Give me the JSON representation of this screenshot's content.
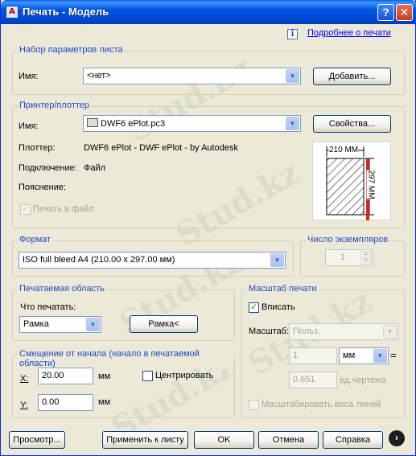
{
  "window": {
    "title": "Печать - Модель",
    "app_icon": "autocad-icon",
    "help_glyph": "?",
    "close_glyph": "✕"
  },
  "help_link": "Подробнее о печати",
  "page_setup": {
    "legend": "Набор параметров листа",
    "name_label": "Имя:",
    "name_value": "<нет>",
    "add_button": "Добавить..."
  },
  "printer": {
    "legend": "Принтер/плоттер",
    "name_label": "Имя:",
    "name_value": "DWF6 ePlot.pc3",
    "properties_button": "Свойства...",
    "plotter_label": "Плоттер:",
    "plotter_value": "DWF6 ePlot - DWF ePlot - by Autodesk",
    "connection_label": "Подключение:",
    "connection_value": "Файл",
    "note_label": "Пояснение:",
    "print_to_file_label": "Печать в файл",
    "print_to_file_checked": true,
    "preview_width": "210 MM",
    "preview_height": "297 MM"
  },
  "format": {
    "legend": "Формат",
    "value": "ISO full bleed A4 (210.00 x 297.00 мм)"
  },
  "copies": {
    "legend": "Число экземпляров",
    "value": "1"
  },
  "plot_area": {
    "legend": "Печатаемая область",
    "what_label": "Что печатать:",
    "what_value": "Рамка",
    "window_button": "Рамка<"
  },
  "offset": {
    "legend": "Смещение от начала (начало в печатаемой области)",
    "x_label": "X:",
    "x_value": "20.00",
    "x_unit": "мм",
    "y_label": "Y:",
    "y_value": "0.00",
    "y_unit": "мм",
    "center_label": "Центрировать",
    "center_checked": false
  },
  "scale": {
    "legend": "Масштаб печати",
    "fit_label": "Вписать",
    "fit_checked": true,
    "scale_label": "Масштаб:",
    "scale_value": "Польз.",
    "val1": "1",
    "unit1": "мм",
    "equals": "=",
    "val2": "0.651",
    "unit2": "ед.чертежа",
    "lineweights_label": "Масштабировать веса линий",
    "lineweights_checked": false
  },
  "buttons": {
    "preview": "Просмотр...",
    "apply": "Применить к листу",
    "ok": "OK",
    "cancel": "Отмена",
    "help": "Справка",
    "more": "›"
  },
  "watermark": "Stud.kz"
}
